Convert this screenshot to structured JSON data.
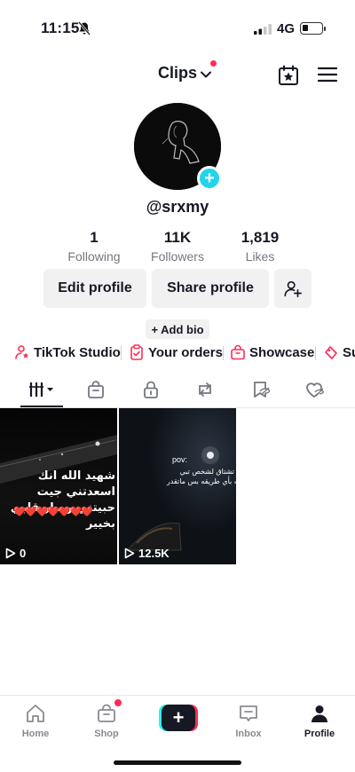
{
  "status": {
    "time": "11:15",
    "network": "4G"
  },
  "header": {
    "title": "Clips"
  },
  "profile": {
    "username": "@srxmy",
    "stats": [
      {
        "value": "1",
        "label": "Following"
      },
      {
        "value": "11K",
        "label": "Followers"
      },
      {
        "value": "1,819",
        "label": "Likes"
      }
    ],
    "edit_label": "Edit profile",
    "share_label": "Share profile",
    "bio_label": "+ Add bio"
  },
  "links": [
    {
      "label": "TikTok Studio",
      "icon": "tiktok-studio-icon"
    },
    {
      "label": "Your orders",
      "icon": "orders-icon"
    },
    {
      "label": "Showcase",
      "icon": "showcase-icon"
    },
    {
      "label": "Su",
      "icon": "subscription-icon"
    }
  ],
  "tabs": [
    "videos-grid-icon",
    "shop-bag-icon",
    "lock-icon",
    "repost-icon",
    "hidden-icon",
    "liked-icon"
  ],
  "videos": [
    {
      "views": "0",
      "caption": "شهيد الله انك اسعدتني جيت\nحبيتني وصار قلبي بخيير",
      "hearts": "❤️❤️❤️❤️❤️❤️❤️"
    },
    {
      "views": "12.5K",
      "pov": "pov:",
      "caption": "فجأه تشتاق لشخص تبي\nتكلمه بأي طريقه بس ماتقدر"
    }
  ],
  "nav": {
    "home": "Home",
    "shop": "Shop",
    "inbox": "Inbox",
    "profile": "Profile"
  },
  "colors": {
    "accent": "#fe2c55",
    "cyan": "#25f4ee",
    "avatar_add": "#20d5ec"
  }
}
